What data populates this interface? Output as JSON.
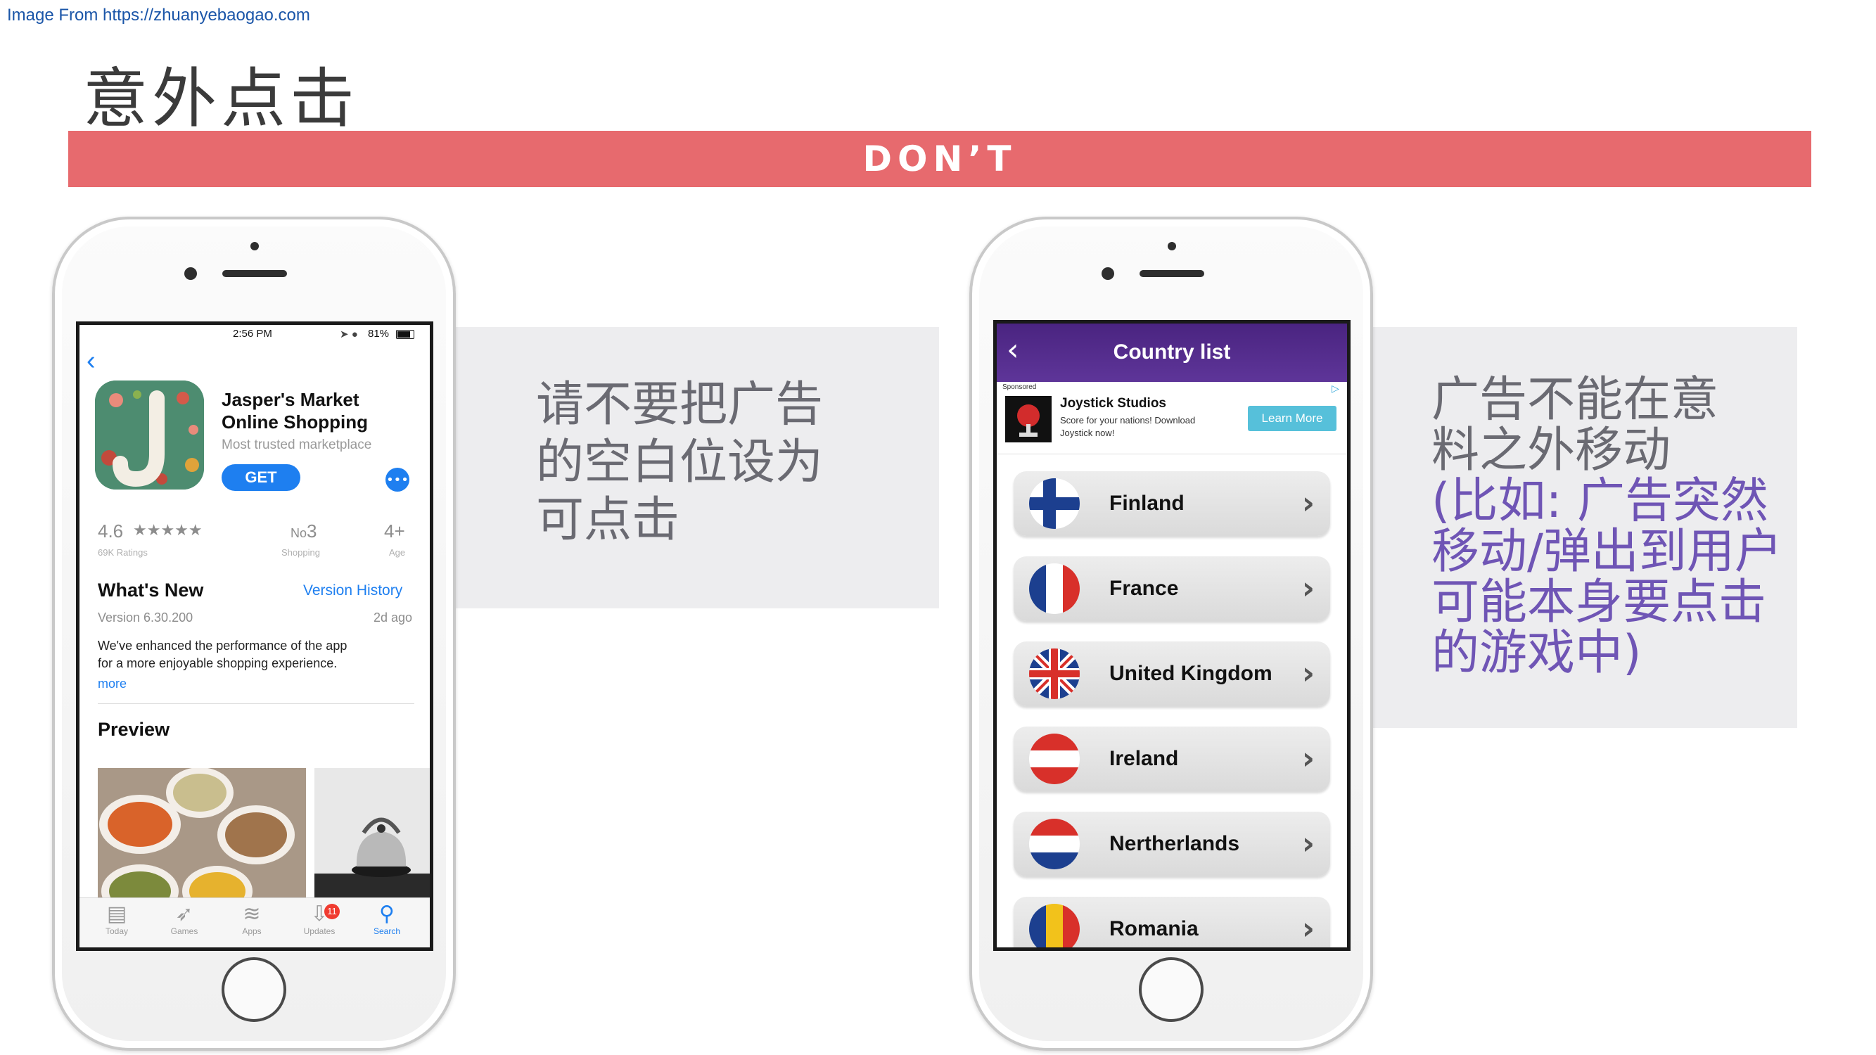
{
  "source": {
    "text": "Image From https://zhuanyebaogao.com"
  },
  "slide": {
    "title": "意外点击",
    "banner": "DON’T",
    "left_panel_lines": [
      "请不要把广告",
      "的空白位设为",
      "可点击"
    ],
    "right_panel_gray_lines": [
      "广告不能在意",
      "料之外移动"
    ],
    "right_panel_purple_lines": [
      "(比如: 广告突然",
      "移动/弹出到用户",
      "可能本身要点击",
      "的游戏中)"
    ]
  },
  "colors": {
    "banner": "#e76a6e",
    "panel": "#ededef",
    "accent_blue": "#1e7ff0",
    "header_purple": "#5e3599"
  },
  "app_store": {
    "status_time": "2:56 PM",
    "status_battery": "81%",
    "back_icon": "chevron-left-icon",
    "app_name_line1": "Jasper's Market",
    "app_name_line2": "Online Shopping",
    "subtitle": "Most trusted marketplace",
    "get_label": "GET",
    "more_label": "•••",
    "rating": "4.6",
    "stars": "★★★★★",
    "ratings_count": "69K Ratings",
    "rank_prefix": "No",
    "rank": "3",
    "rank_category": "Shopping",
    "age": "4+",
    "age_label": "Age",
    "whats_new": "What's New",
    "version_history": "Version History",
    "version": "Version 6.30.200",
    "version_age": "2d ago",
    "notes_line1": "We've enhanced the performance of the app",
    "notes_line2": "for a more enjoyable shopping experience.",
    "more": "more",
    "preview": "Preview",
    "tabs": [
      {
        "label": "Today",
        "icon": "today-icon",
        "glyph": "▤"
      },
      {
        "label": "Games",
        "icon": "rocket-icon",
        "glyph": "➶"
      },
      {
        "label": "Apps",
        "icon": "layers-icon",
        "glyph": "≋"
      },
      {
        "label": "Updates",
        "icon": "download-icon",
        "glyph": "⇩",
        "badge": "11"
      },
      {
        "label": "Search",
        "icon": "search-icon",
        "glyph": "⚲"
      }
    ]
  },
  "country_app": {
    "title": "Country list",
    "back_icon": "chevron-left-icon",
    "ad": {
      "sponsored": "Sponsored",
      "brand": "Joystick Studios",
      "text_line1": "Score for your nations! Download",
      "text_line2": "Joystick now!",
      "cta": "Learn More",
      "adchoices_icon": "adchoices-icon"
    },
    "countries": [
      {
        "name": "Finland",
        "flag": "finland-flag-icon"
      },
      {
        "name": "France",
        "flag": "france-flag-icon"
      },
      {
        "name": "United Kingdom",
        "flag": "uk-flag-icon"
      },
      {
        "name": "Ireland",
        "flag": "austria-style-flag-icon"
      },
      {
        "name": "Nertherlands",
        "flag": "netherlands-flag-icon"
      },
      {
        "name": "Romania",
        "flag": "romania-flag-icon"
      }
    ]
  }
}
